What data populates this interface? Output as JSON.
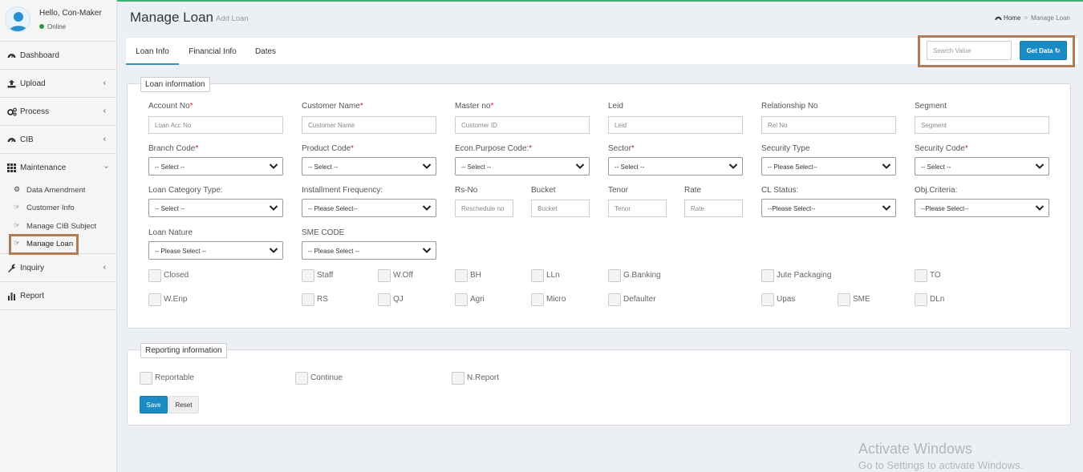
{
  "user": {
    "greeting": "Hello, Con-Maker",
    "status": "Online"
  },
  "sidebar": {
    "items": [
      {
        "label": "Dashboard",
        "icon": "dashboard-icon"
      },
      {
        "label": "Upload",
        "icon": "upload-icon"
      },
      {
        "label": "Process",
        "icon": "cogs-icon"
      },
      {
        "label": "CIB",
        "icon": "dashboard-icon"
      },
      {
        "label": "Maintenance",
        "icon": "th-icon"
      },
      {
        "label": "Inquiry",
        "icon": "wrench-icon"
      },
      {
        "label": "Report",
        "icon": "bar-chart-icon"
      }
    ],
    "maintenance_subitems": [
      {
        "label": "Data Amendment",
        "icon": "gear-icon"
      },
      {
        "label": "Customer Info",
        "icon": "hand-pointer-icon"
      },
      {
        "label": "Manage CIB Subject",
        "icon": "hand-pointer-icon"
      },
      {
        "label": "Manage Loan",
        "icon": "hand-pointer-icon"
      }
    ]
  },
  "header": {
    "title": "Manage Loan",
    "subtitle": "Add Loan",
    "breadcrumb_home": "Home",
    "breadcrumb_sep": ">",
    "breadcrumb_current": "Manage Loan"
  },
  "tabs": [
    "Loan Info",
    "Financial Info",
    "Dates"
  ],
  "search": {
    "placeholder": "Search Value",
    "button": "Get Data"
  },
  "loan_info": {
    "legend": "Loan information",
    "fields": {
      "account_no": {
        "label": "Account No",
        "placeholder": "Loan Acc No"
      },
      "customer_name": {
        "label": "Customer Name",
        "placeholder": "Customer Name"
      },
      "master_no": {
        "label": "Master no",
        "placeholder": "Customer ID"
      },
      "leid": {
        "label": "Leid",
        "placeholder": "Leid"
      },
      "relationship_no": {
        "label": "Relationship No",
        "placeholder": "Rel No"
      },
      "segment": {
        "label": "Segment",
        "placeholder": "Segment"
      },
      "branch_code": {
        "label": "Branch Code",
        "value": "-- Select --"
      },
      "product_code": {
        "label": "Product Code",
        "value": "-- Select --"
      },
      "econ_purpose": {
        "label": "Econ.Purpose Code:",
        "value": "-- Select --"
      },
      "sector": {
        "label": "Sector",
        "value": "-- Select --"
      },
      "security_type": {
        "label": "Security Type",
        "value": "-- Please Select--"
      },
      "security_code": {
        "label": "Security Code",
        "value": "-- Select --"
      },
      "loan_category": {
        "label": "Loan Category Type:",
        "value": "-- Select --"
      },
      "installment_freq": {
        "label": "Installment Frequency:",
        "value": "-- Please Select--"
      },
      "rs_no": {
        "label": "Rs-No",
        "placeholder": "Reschedule no"
      },
      "bucket": {
        "label": "Bucket",
        "placeholder": "Bucket"
      },
      "tenor": {
        "label": "Tenor",
        "placeholder": "Tenor"
      },
      "rate": {
        "label": "Rate",
        "placeholder": "Rate"
      },
      "cl_status": {
        "label": "CL Status:",
        "value": "--Please Select--"
      },
      "obj_criteria": {
        "label": "Obj.Criteria:",
        "value": "--Please Select--"
      },
      "loan_nature": {
        "label": "Loan Nature",
        "value": "-- Please Select --"
      },
      "sme_code": {
        "label": "SME CODE",
        "value": "-- Please Select --"
      }
    },
    "checkboxes_row1": [
      "Closed",
      "Staff",
      "W.Off",
      "BH",
      "LLn",
      "G.Banking",
      "Jute Packaging",
      "TO"
    ],
    "checkboxes_row2": [
      "W.Enp",
      "RS",
      "QJ",
      "Agri",
      "Micro",
      "Defaulter",
      "Upas",
      "SME",
      "DLn"
    ]
  },
  "reporting": {
    "legend": "Reporting information",
    "checkboxes": [
      "Reportable",
      "Continue",
      "N.Report"
    ],
    "save": "Save",
    "reset": "Reset"
  },
  "watermark": {
    "line1": "Activate Windows",
    "line2": "Go to Settings to activate Windows."
  }
}
